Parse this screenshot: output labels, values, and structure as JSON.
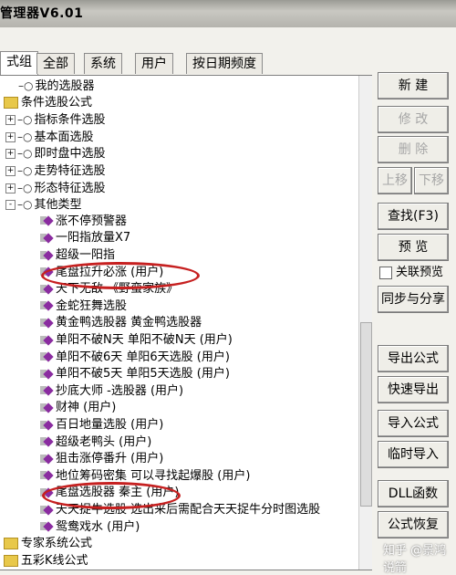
{
  "title": "管理器V6.01",
  "tabs": [
    "式组",
    "全部",
    "系统",
    "用户",
    "按日期频度"
  ],
  "tree": [
    {
      "label": "我的选股器",
      "kind": "key",
      "indent": 1
    },
    {
      "label": "条件选股公式",
      "kind": "folder",
      "indent": 0
    },
    {
      "label": "指标条件选股",
      "kind": "key",
      "indent": 1,
      "exp": "+"
    },
    {
      "label": "基本面选股",
      "kind": "key",
      "indent": 1,
      "exp": "+"
    },
    {
      "label": "即时盘中选股",
      "kind": "key",
      "indent": 1,
      "exp": "+"
    },
    {
      "label": "走势特征选股",
      "kind": "key",
      "indent": 1,
      "exp": "+"
    },
    {
      "label": "形态特征选股",
      "kind": "key",
      "indent": 1,
      "exp": "+"
    },
    {
      "label": "其他类型",
      "kind": "key",
      "indent": 1,
      "exp": "-"
    },
    {
      "label": "涨不停预警器",
      "kind": "item",
      "indent": 2
    },
    {
      "label": "一阳指放量X7",
      "kind": "item",
      "indent": 2
    },
    {
      "label": "超级一阳指",
      "kind": "item",
      "indent": 2
    },
    {
      "label": "尾盘拉升必涨  (用户)",
      "kind": "item",
      "indent": 2
    },
    {
      "label": "天下无敌  《野蛮家族》",
      "kind": "item",
      "indent": 2
    },
    {
      "label": "金蛇狂舞选股",
      "kind": "item",
      "indent": 2
    },
    {
      "label": "黄金鸭选股器  黄金鸭选股器",
      "kind": "item",
      "indent": 2
    },
    {
      "label": "单阳不破N天  单阳不破N天 (用户)",
      "kind": "item",
      "indent": 2
    },
    {
      "label": "单阳不破6天  单阳6天选股 (用户)",
      "kind": "item",
      "indent": 2
    },
    {
      "label": "单阳不破5天  单阳5天选股 (用户)",
      "kind": "item",
      "indent": 2
    },
    {
      "label": "抄底大师  -选股器 (用户)",
      "kind": "item",
      "indent": 2
    },
    {
      "label": "财神  (用户)",
      "kind": "item",
      "indent": 2
    },
    {
      "label": "百日地量选股  (用户)",
      "kind": "item",
      "indent": 2
    },
    {
      "label": "超级老鸭头  (用户)",
      "kind": "item",
      "indent": 2
    },
    {
      "label": "狙击涨停番升  (用户)",
      "kind": "item",
      "indent": 2
    },
    {
      "label": "地位筹码密集  可以寻找起爆股 (用户)",
      "kind": "item",
      "indent": 2
    },
    {
      "label": "尾盘选股器  秦主 (用户)",
      "kind": "item",
      "indent": 2
    },
    {
      "label": "天天捉牛选股  选出来后需配合天天捉牛分时图选股",
      "kind": "item",
      "indent": 2
    },
    {
      "label": "鸳鸯戏水  (用户)",
      "kind": "item",
      "indent": 2
    },
    {
      "label": "专家系统公式",
      "kind": "folder",
      "indent": 0
    },
    {
      "label": "五彩K线公式",
      "kind": "folder",
      "indent": 0
    }
  ],
  "buttons": {
    "new": "新 建",
    "modify": "修 改",
    "delete": "删 除",
    "up": "上移",
    "down": "下移",
    "find": "查找(F3)",
    "preview": "预 览",
    "sync": "同步与分享",
    "export": "导出公式",
    "quick_export": "快速导出",
    "import": "导入公式",
    "temp_import": "临时导入",
    "dll": "DLL函数",
    "restore": "公式恢复"
  },
  "checkbox": {
    "label": "关联预览",
    "checked": false
  },
  "watermark": "知乎 @景鸿说箭"
}
